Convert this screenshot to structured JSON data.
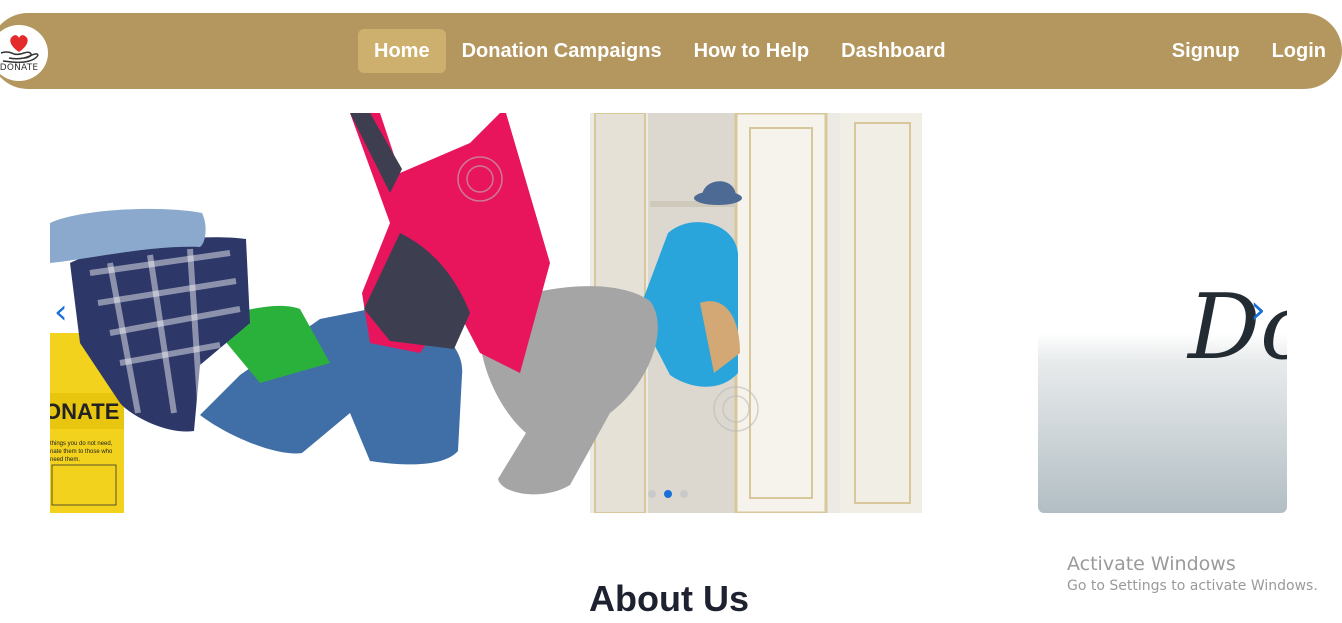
{
  "nav": {
    "logo_text": "DONATE",
    "links": [
      "Home",
      "Donation Campaigns",
      "How to Help",
      "Dashboard"
    ],
    "active": "Home",
    "auth": [
      "Signup",
      "Login"
    ],
    "bg_color": "#b3975e",
    "active_color": "#cdaf6e"
  },
  "carousel": {
    "slide_image": "clothes-donation-photo",
    "slide_bin_text": "ONATE",
    "slide_bin_small": [
      "things you do not need,",
      "nate them to those who",
      "need them."
    ],
    "next_slide_text": "Do",
    "prev_icon": "‹",
    "next_icon": "›",
    "dot_count": 3,
    "active_dot": 1
  },
  "about": {
    "title": "About Us"
  },
  "overlay": {
    "title": "Activate Windows",
    "subtitle": "Go to Settings to activate Windows."
  }
}
